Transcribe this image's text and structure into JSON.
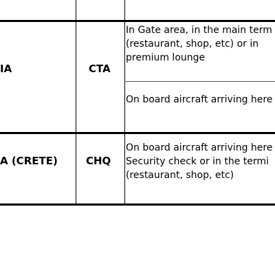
{
  "rows": [
    {
      "airport": "IA",
      "code": "CTA",
      "locations": [
        [
          "In Gate area, in the main term",
          "(restaurant, shop, etc) or in",
          "premium lounge"
        ],
        [
          "On board aircraft arriving here"
        ]
      ]
    },
    {
      "airport": "A (CRETE)",
      "code": "CHQ",
      "locations": [
        [
          "On board aircraft arriving here",
          "Security check or in the termi",
          "(restaurant, shop, etc)"
        ]
      ]
    }
  ]
}
